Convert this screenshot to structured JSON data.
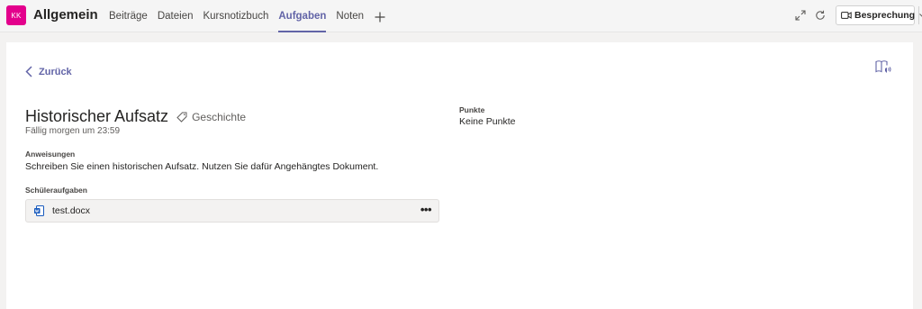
{
  "header": {
    "avatar_initials": "KK",
    "channel_title": "Allgemein",
    "tabs": [
      {
        "label": "Beiträge"
      },
      {
        "label": "Dateien"
      },
      {
        "label": "Kursnotizbuch"
      },
      {
        "label": "Aufgaben",
        "active": true
      },
      {
        "label": "Noten"
      }
    ],
    "add_tab_icon": "plus-icon",
    "meet_button_label": "Besprechung"
  },
  "assignment": {
    "back_label": "Zurück",
    "title": "Historischer Aufsatz",
    "category": "Geschichte",
    "due": "Fällig morgen um 23:59",
    "instructions_label": "Anweisungen",
    "instructions_text": "Schreiben Sie einen historischen Aufsatz. Nutzen Sie dafür Angehängtes Dokument.",
    "student_work_label": "Schüleraufgaben",
    "file": {
      "name": "test.docx",
      "more": "•••"
    },
    "points_label": "Punkte",
    "points_value": "Keine Punkte"
  },
  "colors": {
    "accent": "#6264a7",
    "avatar": "#e3008c",
    "word_icon": "#185abd"
  }
}
